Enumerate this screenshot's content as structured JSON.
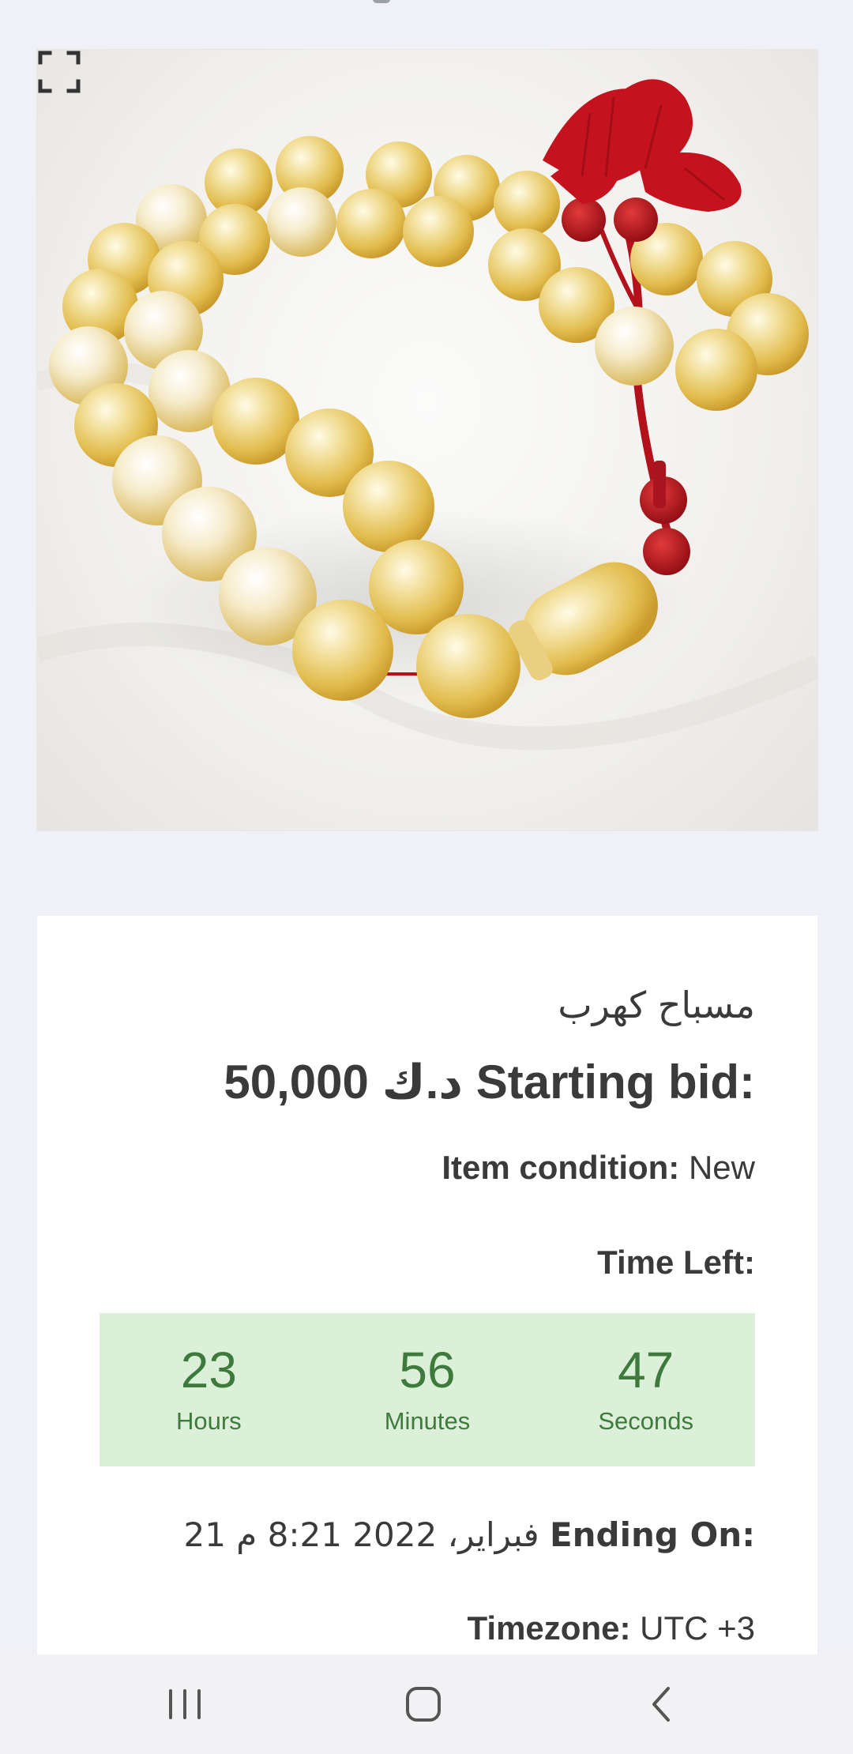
{
  "listing": {
    "title": "مسباح كهرب",
    "starting_bid_label": "Starting bid:",
    "starting_bid_value": "50,000 د.ك",
    "condition_label": "Item condition:",
    "condition_value": "New",
    "time_left_label": "Time Left:",
    "countdown": {
      "hours": "23",
      "hours_label": "Hours",
      "minutes": "56",
      "minutes_label": "Minutes",
      "seconds": "47",
      "seconds_label": "Seconds"
    },
    "ending_on_label": "Ending On:",
    "ending_on_value": "21 فبراير، 2022 8:21 م",
    "timezone_label": "Timezone:",
    "timezone_value": "UTC +3"
  },
  "photo": {
    "subject": "amber prayer beads with red tassel",
    "expand_icon": "expand-icon"
  },
  "navigation": {
    "recents_icon": "recents-icon",
    "home_icon": "home-icon",
    "back_icon": "back-icon"
  },
  "colors": {
    "background": "#eff1f6",
    "countdown_bg": "#dcefd9",
    "countdown_text": "#3e7a3c",
    "text": "#3a3a3a"
  }
}
